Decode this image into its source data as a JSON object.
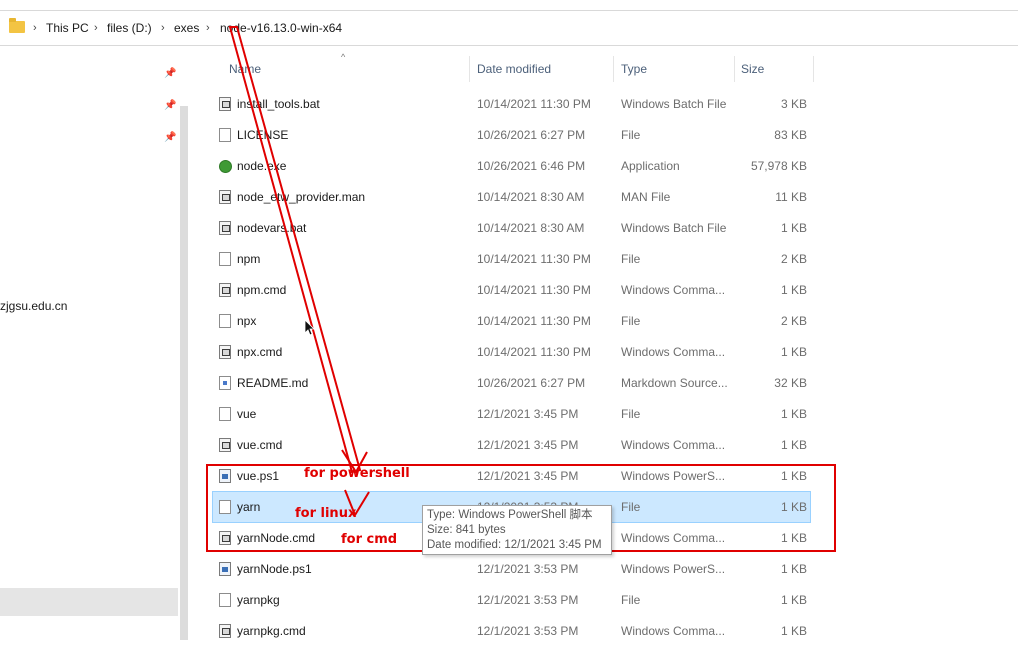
{
  "breadcrumb": {
    "items": [
      "This PC",
      "files (D:)",
      "exes",
      "node-v16.13.0-win-x64"
    ],
    "separator": "›"
  },
  "navigation": {
    "partial_label": "zjgsu.edu.cn",
    "pin_glyph": "📌"
  },
  "columns": {
    "name": "Name",
    "date": "Date modified",
    "type": "Type",
    "size": "Size",
    "sort_glyph": "^"
  },
  "files": [
    {
      "name": "install_tools.bat",
      "date": "10/14/2021 11:30 PM",
      "type": "Windows Batch File",
      "size": "3 KB",
      "icon": "batch-file-icon"
    },
    {
      "name": "LICENSE",
      "date": "10/26/2021 6:27 PM",
      "type": "File",
      "size": "83 KB",
      "icon": "file-icon"
    },
    {
      "name": "node.exe",
      "date": "10/26/2021 6:46 PM",
      "type": "Application",
      "size": "57,978 KB",
      "icon": "node-exe-icon"
    },
    {
      "name": "node_etw_provider.man",
      "date": "10/14/2021 8:30 AM",
      "type": "MAN File",
      "size": "11 KB",
      "icon": "batch-file-icon"
    },
    {
      "name": "nodevars.bat",
      "date": "10/14/2021 8:30 AM",
      "type": "Windows Batch File",
      "size": "1 KB",
      "icon": "batch-file-icon"
    },
    {
      "name": "npm",
      "date": "10/14/2021 11:30 PM",
      "type": "File",
      "size": "2 KB",
      "icon": "file-icon"
    },
    {
      "name": "npm.cmd",
      "date": "10/14/2021 11:30 PM",
      "type": "Windows Comma...",
      "size": "1 KB",
      "icon": "batch-file-icon"
    },
    {
      "name": "npx",
      "date": "10/14/2021 11:30 PM",
      "type": "File",
      "size": "2 KB",
      "icon": "file-icon"
    },
    {
      "name": "npx.cmd",
      "date": "10/14/2021 11:30 PM",
      "type": "Windows Comma...",
      "size": "1 KB",
      "icon": "batch-file-icon"
    },
    {
      "name": "README.md",
      "date": "10/26/2021 6:27 PM",
      "type": "Markdown Source...",
      "size": "32 KB",
      "icon": "markdown-file-icon"
    },
    {
      "name": "vue",
      "date": "12/1/2021 3:45 PM",
      "type": "File",
      "size": "1 KB",
      "icon": "file-icon"
    },
    {
      "name": "vue.cmd",
      "date": "12/1/2021 3:45 PM",
      "type": "Windows Comma...",
      "size": "1 KB",
      "icon": "batch-file-icon"
    },
    {
      "name": "vue.ps1",
      "date": "12/1/2021 3:45 PM",
      "type": "Windows PowerS...",
      "size": "1 KB",
      "icon": "powershell-file-icon"
    },
    {
      "name": "yarn",
      "date": "12/1/2021 3:53 PM",
      "type": "File",
      "size": "1 KB",
      "icon": "file-icon",
      "selected": true
    },
    {
      "name": "yarnNode.cmd",
      "date": "12/1/2021 3:53 PM",
      "type": "Windows Comma...",
      "size": "1 KB",
      "icon": "batch-file-icon"
    },
    {
      "name": "yarnNode.ps1",
      "date": "12/1/2021 3:53 PM",
      "type": "Windows PowerS...",
      "size": "1 KB",
      "icon": "powershell-file-icon"
    },
    {
      "name": "yarnpkg",
      "date": "12/1/2021 3:53 PM",
      "type": "File",
      "size": "1 KB",
      "icon": "file-icon"
    },
    {
      "name": "yarnpkg.cmd",
      "date": "12/1/2021 3:53 PM",
      "type": "Windows Comma...",
      "size": "1 KB",
      "icon": "batch-file-icon"
    }
  ],
  "annotations": {
    "powershell": "for powershell",
    "linux": "for linux",
    "cmd": "for cmd",
    "color": "#e00000"
  },
  "tooltip": {
    "type_line": "Type: Windows PowerShell 脚本",
    "size_line": "Size: 841 bytes",
    "date_line": "Date modified: 12/1/2021 3:45 PM"
  },
  "colors": {
    "selection_bg": "#cce8ff",
    "header_text": "#4c607a",
    "folder": "#f3c443"
  }
}
